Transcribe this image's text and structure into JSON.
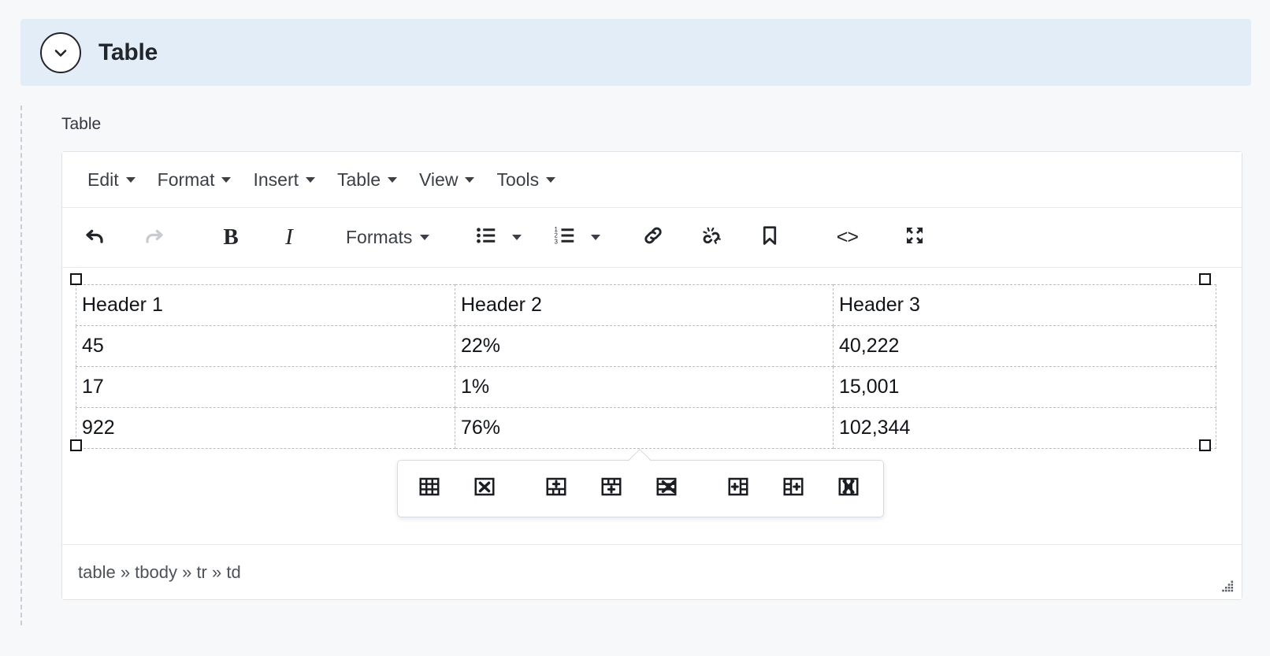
{
  "panel": {
    "title": "Table",
    "toggle_icon": "chevron-down-icon"
  },
  "field": {
    "label": "Table"
  },
  "editor": {
    "menubar": [
      {
        "label": "Edit"
      },
      {
        "label": "Format"
      },
      {
        "label": "Insert"
      },
      {
        "label": "Table"
      },
      {
        "label": "View"
      },
      {
        "label": "Tools"
      }
    ],
    "toolbar": {
      "undo": {
        "icon": "undo-icon",
        "enabled": true
      },
      "redo": {
        "icon": "redo-icon",
        "enabled": false
      },
      "bold": {
        "icon": "bold-icon",
        "label": "B"
      },
      "italic": {
        "icon": "italic-icon",
        "label": "I"
      },
      "formats": {
        "icon": "formats-dropdown",
        "label": "Formats"
      },
      "bullist": {
        "icon": "bullet-list-icon"
      },
      "numlist": {
        "icon": "numbered-list-icon"
      },
      "link": {
        "icon": "link-icon"
      },
      "unlink": {
        "icon": "unlink-icon"
      },
      "anchor": {
        "icon": "bookmark-icon"
      },
      "sourcecode": {
        "icon": "source-code-icon",
        "label": "<>"
      },
      "fullscreen": {
        "icon": "fullscreen-icon"
      }
    },
    "table": {
      "headers": [
        "Header 1",
        "Header 2",
        "Header 3"
      ],
      "rows": [
        [
          "45",
          "22%",
          "40,222"
        ],
        [
          "17",
          "1%",
          "15,001"
        ],
        [
          "922",
          "76%",
          "102,344"
        ]
      ]
    },
    "float_toolbar": [
      {
        "icon": "table-properties-icon"
      },
      {
        "icon": "delete-table-icon"
      },
      {
        "icon": "insert-row-above-icon"
      },
      {
        "icon": "insert-row-below-icon"
      },
      {
        "icon": "delete-row-icon"
      },
      {
        "icon": "insert-column-before-icon"
      },
      {
        "icon": "insert-column-after-icon"
      },
      {
        "icon": "delete-column-icon"
      }
    ],
    "statusbar": {
      "path": "table » tbody » tr » td",
      "resize_icon": "resize-grip-icon"
    }
  },
  "colors": {
    "panel_header_bg": "#e3edf7",
    "page_bg": "#f7f8fa",
    "editor_border": "#dfe3e8",
    "table_border": "#b9bdc4",
    "text": "#22252a",
    "disabled": "#c7ccd3"
  }
}
